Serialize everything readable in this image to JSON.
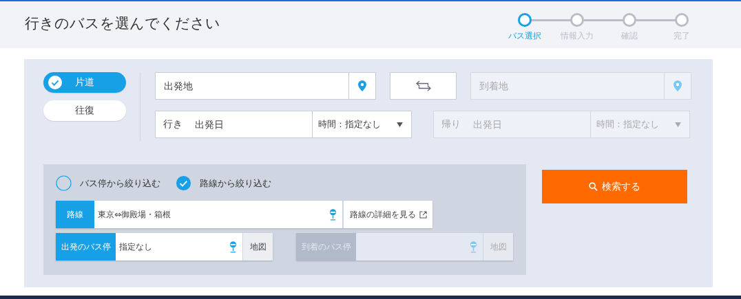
{
  "header": {
    "title": "行きのバスを選んでください",
    "steps": [
      {
        "label": "バス選択",
        "selected": true
      },
      {
        "label": "情報入力",
        "selected": false
      },
      {
        "label": "確認",
        "selected": false
      },
      {
        "label": "完了",
        "selected": false
      }
    ]
  },
  "trip_type": [
    {
      "label": "片道",
      "selected": true
    },
    {
      "label": "往復",
      "selected": false
    }
  ],
  "departure": {
    "placeholder": "出発地",
    "disabled": false
  },
  "arrival": {
    "placeholder": "到着地",
    "disabled": true
  },
  "outbound": {
    "label": "行き",
    "placeholder": "出発日",
    "time": "時間：指定なし",
    "disabled": false
  },
  "return": {
    "label": "帰り",
    "placeholder": "出発日",
    "time": "時間：指定なし",
    "disabled": true
  },
  "filter_modes": [
    {
      "label": "バス停から絞り込む",
      "selected": false
    },
    {
      "label": "路線から絞り込む",
      "selected": true
    }
  ],
  "route": {
    "label": "路線",
    "value": "東京⇔御殿場・箱根",
    "details_link": "路線の詳細を見る"
  },
  "stops": [
    {
      "label": "出発のバス停",
      "value": "指定なし",
      "map": "地図",
      "disabled": false
    },
    {
      "label": "到着のバス停",
      "map": "地図",
      "disabled": true
    }
  ],
  "search_button": "検索する"
}
